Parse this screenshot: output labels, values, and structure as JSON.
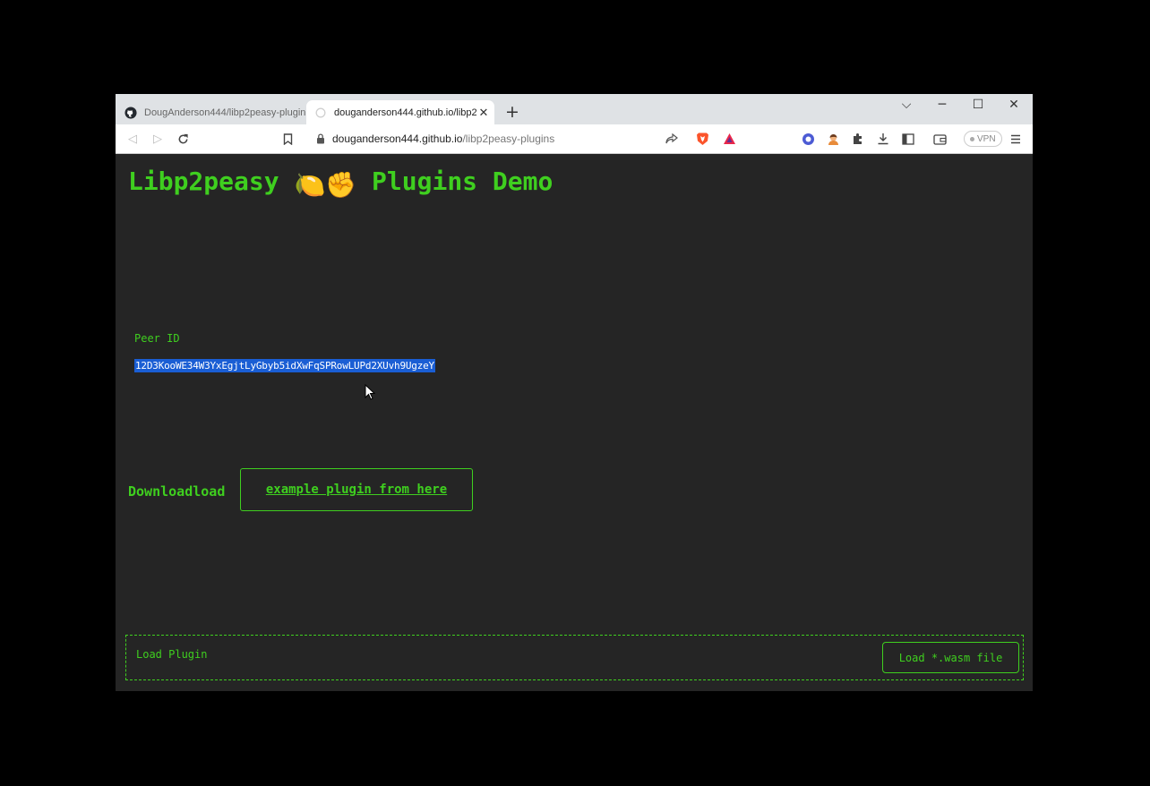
{
  "browser": {
    "tabs": [
      {
        "title": "DougAnderson444/libp2peasy-plugin",
        "active": false
      },
      {
        "title": "douganderson444.github.io/libp2",
        "active": true
      }
    ],
    "new_tab": "+",
    "url_host": "douganderson444.github.io",
    "url_path": "/libp2peasy-plugins",
    "vpn_label": "VPN",
    "window_controls": {
      "dropdown": "⌵",
      "minimize": "─",
      "maximize": "☐",
      "close": "✕"
    }
  },
  "page": {
    "title_text_1": "Libp2peasy",
    "title_emoji": "🍋✊",
    "title_text_2": "Plugins Demo",
    "peer_label": "Peer ID",
    "peer_id": "12D3KooWE34W3YxEgjtLyGbyb5idXwFqSPRowLUPd2XUvh9UgzeY",
    "download_prefix": "Downloadload",
    "download_link": "example plugin from here",
    "load_label": "Load Plugin",
    "load_button": "Load *.wasm file"
  },
  "colors": {
    "accent": "#3fcf1f",
    "page_bg": "#252525",
    "selection": "#1a5ed4"
  }
}
